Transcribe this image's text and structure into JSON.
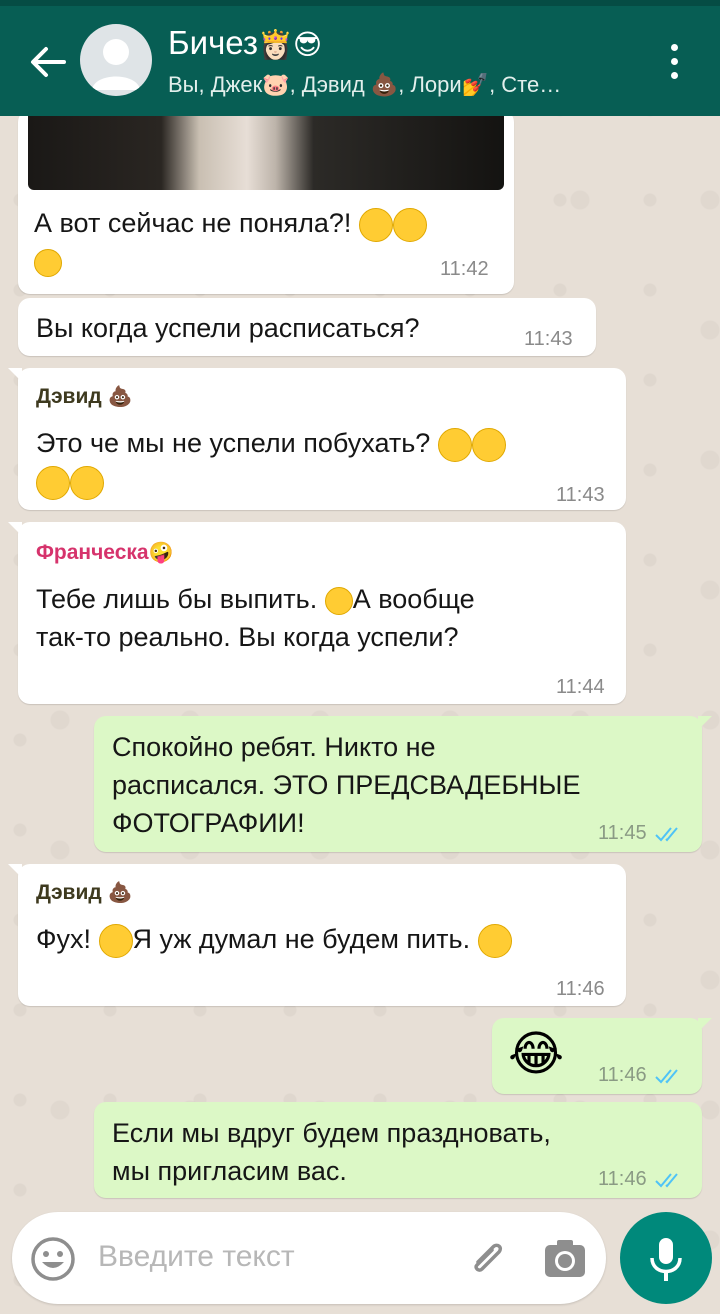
{
  "header": {
    "title": "Бичез",
    "subtitle": "Вы, Джек🐷, Дэвид 💩, Лори💅, Сте…"
  },
  "messages": [
    {
      "dir": "in",
      "text_line1": "А вот сейчас не поняла?!",
      "time": "11:42"
    },
    {
      "dir": "in",
      "text": "Вы когда успели расписаться?",
      "time": "11:43"
    },
    {
      "dir": "in",
      "sender": "Дэвид",
      "text": "Это че мы не успели побухать?",
      "time": "11:43"
    },
    {
      "dir": "in",
      "sender": "Франческа",
      "text_line1": "Тебе лишь бы выпить.",
      "text_line1b": "А вообще",
      "text_line2": "так-то реально. Вы когда успели?",
      "time": "11:44"
    },
    {
      "dir": "out",
      "text_line1": "Спокойно ребят. Никто не",
      "text_line2": "расписался. ЭТО ПРЕДСВАДЕБНЫЕ",
      "text_line3": "ФОТОГРАФИИ!",
      "time": "11:45"
    },
    {
      "dir": "in",
      "sender": "Дэвид",
      "text_a": "Фух!",
      "text_b": "Я уж думал не будем пить.",
      "time": "11:46"
    },
    {
      "dir": "out",
      "emoji": "😂",
      "time": "11:46"
    },
    {
      "dir": "out",
      "text_line1": "Если мы вдруг будем праздновать,",
      "text_line2": "мы пригласим вас.",
      "time": "11:46"
    }
  ],
  "colors": {
    "header": "#075e54",
    "outgoing_bubble": "#dcf8c6",
    "incoming_bubble": "#ffffff",
    "sender_david": "#3e3a1f",
    "sender_francesca": "#d6336c",
    "read_ticks": "#4fc3f7",
    "mic_button": "#00897b"
  },
  "input": {
    "placeholder": "Введите текст"
  },
  "icons": {
    "back": "arrow-left-icon",
    "menu": "more-vertical-icon",
    "emoji": "smiley-icon",
    "attach": "paperclip-icon",
    "camera": "camera-icon",
    "mic": "microphone-icon"
  }
}
